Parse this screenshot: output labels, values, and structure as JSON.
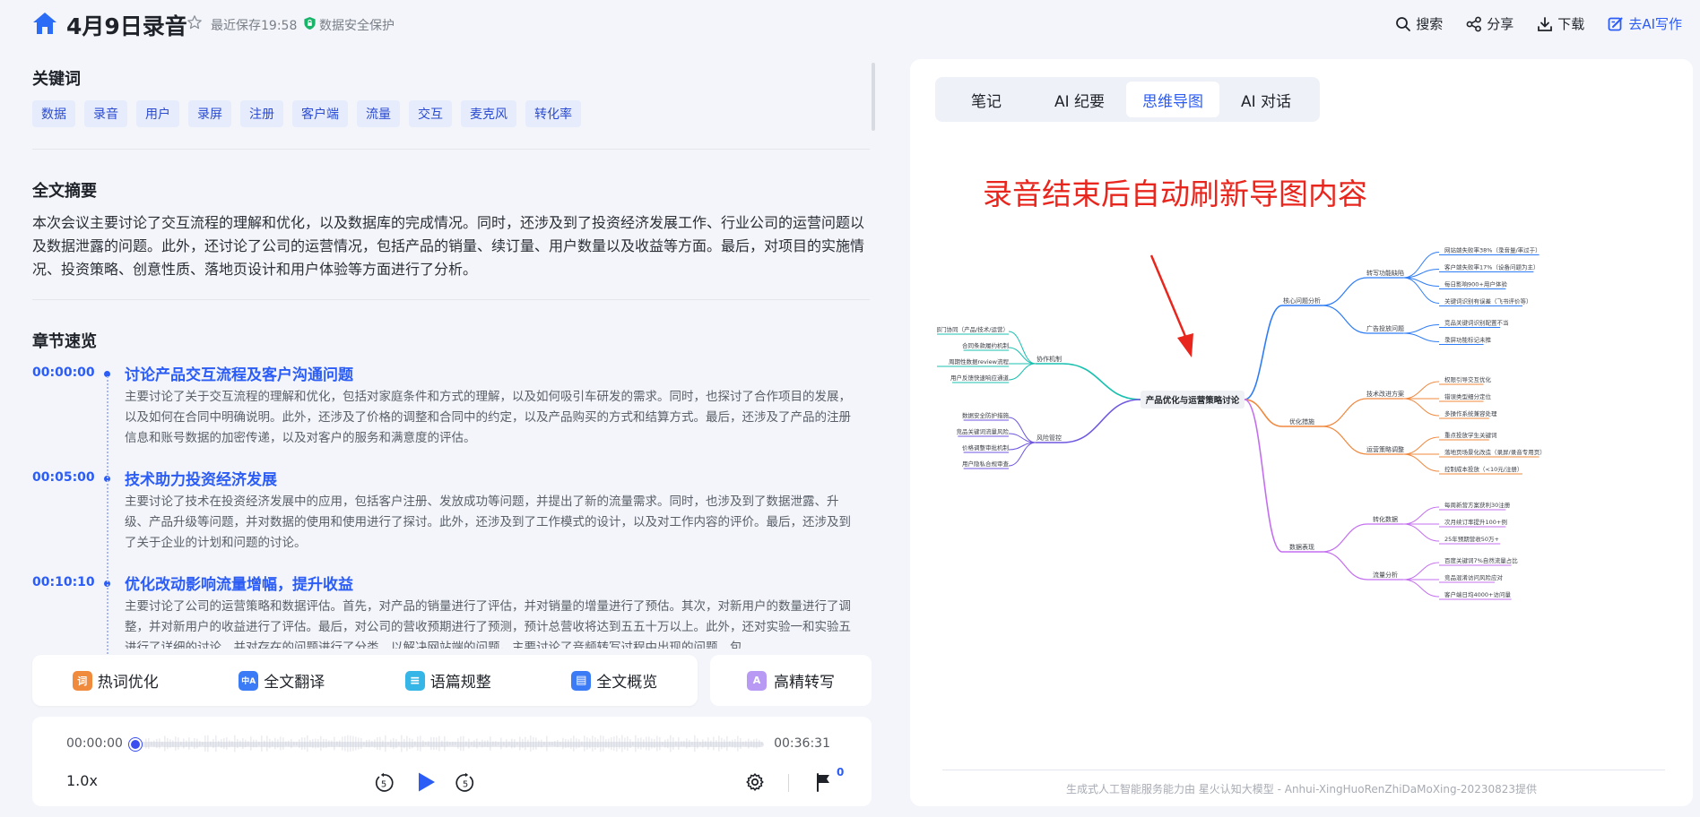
{
  "header": {
    "title": "4月9日录音",
    "saved": "最近保存19:58",
    "secure": "数据安全保护",
    "actions": [
      "搜索",
      "分享",
      "下载",
      "去AI写作"
    ]
  },
  "keywords": {
    "title": "关键词",
    "items": [
      "数据",
      "录音",
      "用户",
      "录屏",
      "注册",
      "客户端",
      "流量",
      "交互",
      "麦克风",
      "转化率"
    ]
  },
  "summary": {
    "title": "全文摘要",
    "text": "本次会议主要讨论了交互流程的理解和优化，以及数据库的完成情况。同时，还涉及到了投资经济发展工作、行业公司的运营问题以及数据泄露的问题。此外，还讨论了公司的运营情况，包括产品的销量、续订量、用户数量以及收益等方面。最后，对项目的实施情况、投资策略、创意性质、落地页设计和用户体验等方面进行了分析。"
  },
  "chapters": {
    "title": "章节速览",
    "items": [
      {
        "time": "00:00:00",
        "heading": "讨论产品交互流程及客户沟通问题",
        "body": "主要讨论了关于交互流程的理解和优化，包括对家庭条件和方式的理解，以及如何吸引车研发的需求。同时，也探讨了合作项目的发展，以及如何在合同中明确说明。此外，还涉及了价格的调整和合同中的约定，以及产品购买的方式和结算方式。最后，还涉及了产品的注册信息和账号数据的加密传递，以及对客户的服务和满意度的评估。"
      },
      {
        "time": "00:05:00",
        "heading": "技术助力投资经济发展",
        "body": "主要讨论了技术在投资经济发展中的应用，包括客户注册、发放成功等问题，并提出了新的流量需求。同时，也涉及到了数据泄露、升级、产品升级等问题，并对数据的使用和使用进行了探讨。此外，还涉及到了工作模式的设计，以及对工作内容的评价。最后，还涉及到了关于企业的计划和问题的讨论。"
      },
      {
        "time": "00:10:10",
        "heading": "优化改动影响流量增幅，提升收益",
        "body": "主要讨论了公司的运营策略和数据评估。首先，对产品的销量进行了评估，并对销量的增量进行了预估。其次，对新用户的数量进行了调整，并对新用户的收益进行了评估。最后，对公司的营收预期进行了预测，预计总营收将达到五五十万以上。此外，还对实验一和实验五进行了详细的讨论，并对存在的问题进行了分类，以解决网站端的问题。主要讨论了音频转写过程中出现的问题，包"
      }
    ]
  },
  "tools": {
    "items": [
      {
        "label": "热词优化",
        "icon": "hotword-icon",
        "glyph": "词",
        "color": "#f08a3c"
      },
      {
        "label": "全文翻译",
        "icon": "translate-icon",
        "glyph": "中A",
        "color": "#3b7cf6"
      },
      {
        "label": "语篇规整",
        "icon": "format-icon",
        "glyph": "≡",
        "color": "#36b6e6"
      },
      {
        "label": "全文概览",
        "icon": "overview-icon",
        "glyph": "▤",
        "color": "#3b7cf6"
      }
    ],
    "hq": {
      "label": "高精转写",
      "glyph": "A",
      "color": "#a784f0"
    }
  },
  "player": {
    "current": "00:00:00",
    "total": "00:36:31",
    "progress": 0,
    "speed": "1.0x",
    "skip_seconds": "5",
    "flag_count": "0"
  },
  "right": {
    "tabs": [
      "笔记",
      "AI 纪要",
      "思维导图",
      "AI 对话"
    ],
    "active_tab": 2,
    "note": "录音结束后自动刷新导图内容",
    "footer": "生成式人工智能服务能力由 星火认知大模型 - Anhui-XingHuoRenZhiDaMoXing-20230823提供"
  },
  "mindmap": {
    "root": "产品优化与运营策略讨论",
    "left": [
      {
        "label": "协作机制",
        "color": "#19c0b0",
        "children": [
          "跨部门协同（产品/技术/运营）",
          "合同条款履约机制",
          "周期性数据review流程",
          "用户反馈快速响应通道"
        ]
      },
      {
        "label": "风险管控",
        "color": "#6f56e0",
        "children": [
          "数据安全防护措施",
          "竞品关键词流量风险",
          "价格调整审批机制",
          "用户隐私合规审查"
        ]
      }
    ],
    "right": [
      {
        "label": "核心问题分析",
        "color": "#2e7cf6",
        "groups": [
          {
            "label": "转写功能缺陷",
            "children": [
              "网站端失败率38%（录音量/率过于）",
              "客户端失败率17%（设备问题为主）",
              "每日影响900+用户体验",
              "关键词识别有误差（飞书评价等）"
            ]
          },
          {
            "label": "广告投放问题",
            "children": [
              "竞品关键词识别配置不当",
              "录屏功能标记未推"
            ]
          }
        ]
      },
      {
        "label": "优化措施",
        "color": "#f0883e",
        "groups": [
          {
            "label": "技术改进方案",
            "children": [
              "权限引导交互优化",
              "错误类型细分定位",
              "多操作系统兼容处理"
            ]
          },
          {
            "label": "运营策略调整",
            "children": [
              "重点投放学生关键词",
              "落地页场景化改造（录屏/录音专用页）",
              "控制成本投放（<10元/注册）"
            ]
          }
        ]
      },
      {
        "label": "数据表现",
        "color": "#c36ff0",
        "groups": [
          {
            "label": "转化数据",
            "children": [
              "每周新营方案获利30注册",
              "次月续订率提升100+例",
              "25年预期营收50万+"
            ]
          },
          {
            "label": "流量分析",
            "children": [
              "百度关键词7%自然流量占比",
              "竞品混淆访问风险应对",
              "客户端日均4000+访问量"
            ]
          }
        ]
      }
    ]
  }
}
